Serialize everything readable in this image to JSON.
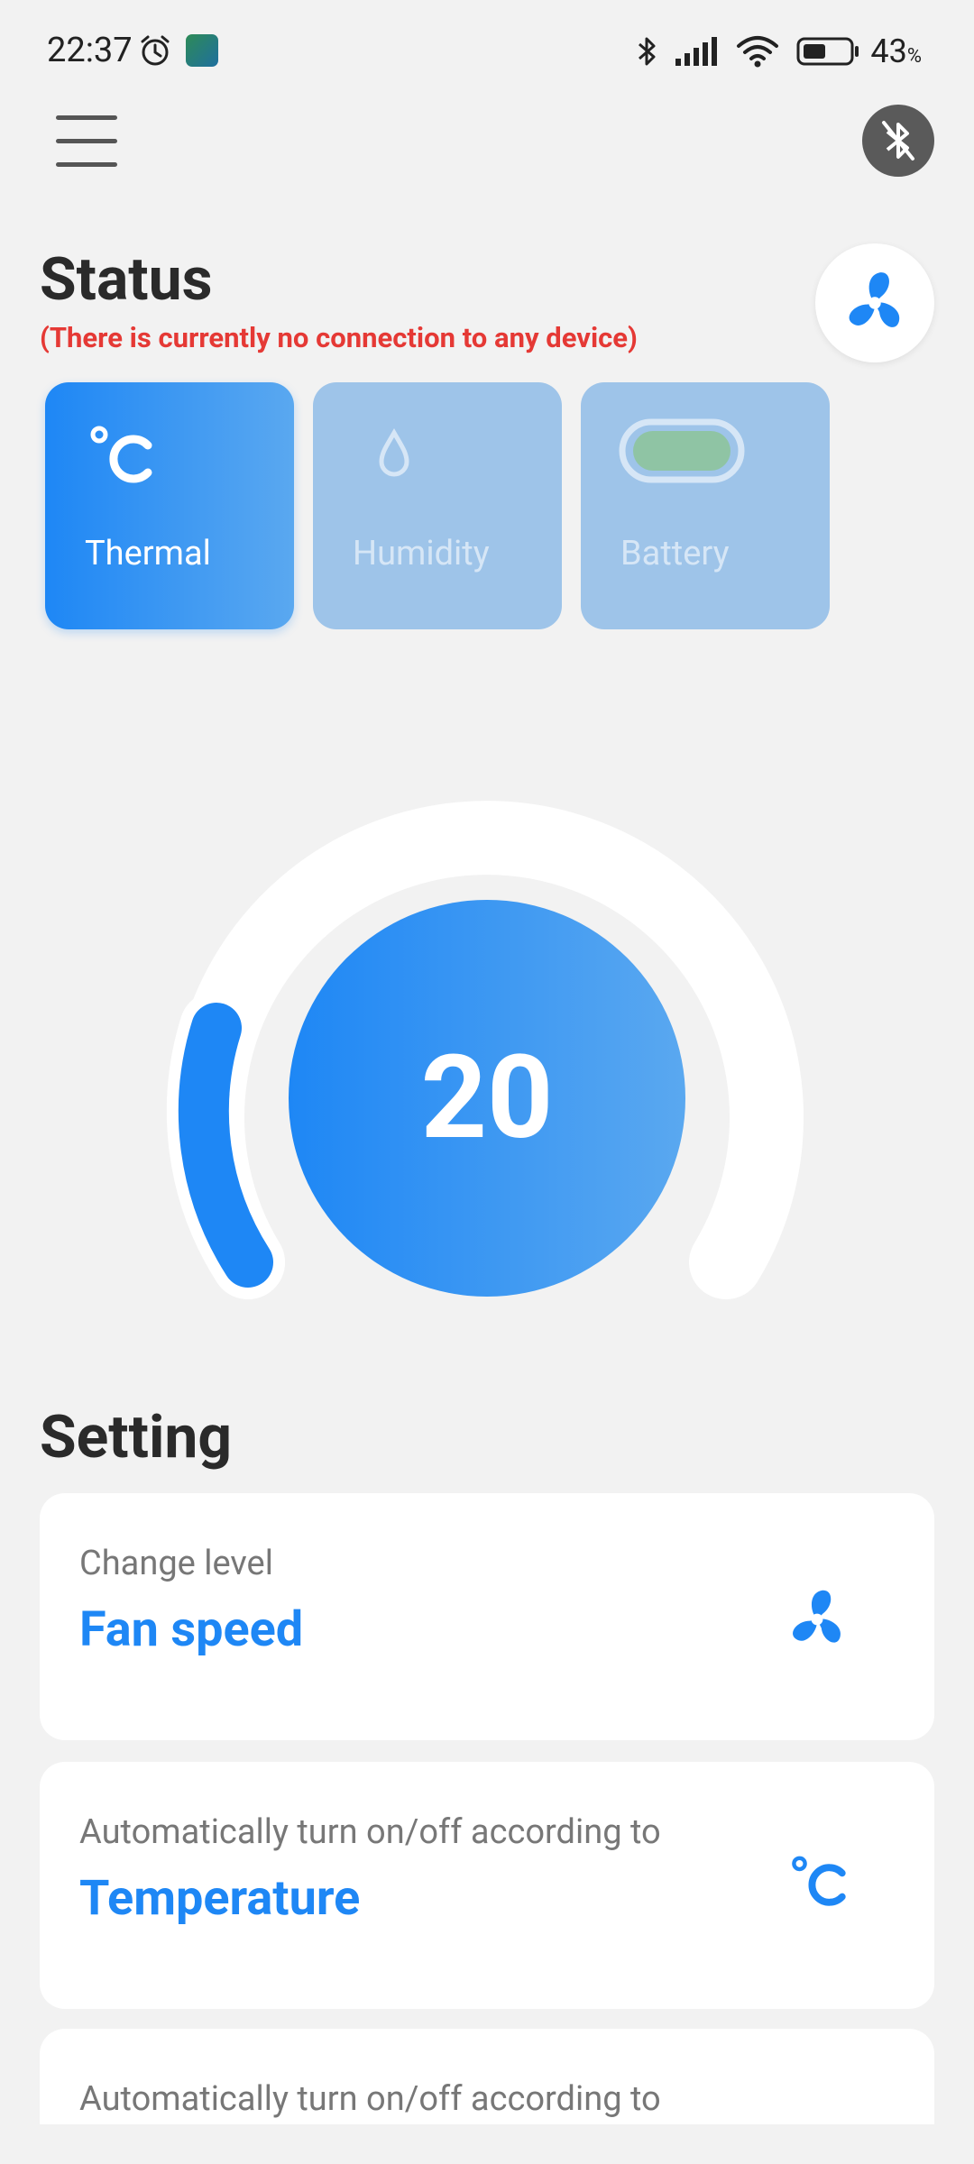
{
  "status_bar": {
    "time": "22:37",
    "battery": "43",
    "battery_unit": "%"
  },
  "status": {
    "title": "Status",
    "warning": "(There is currently no connection to any device)",
    "cards": [
      {
        "label": "Thermal",
        "icon": "celsius-icon",
        "active": true
      },
      {
        "label": "Humidity",
        "icon": "droplet-icon",
        "active": false
      },
      {
        "label": "Battery",
        "icon": "battery-pill-icon",
        "active": false
      }
    ]
  },
  "dial": {
    "value": "20"
  },
  "setting": {
    "title": "Setting",
    "items": [
      {
        "subtitle": "Change level",
        "title": "Fan speed",
        "icon": "fan-icon"
      },
      {
        "subtitle": "Automatically turn on/off according to",
        "title": "Temperature",
        "icon": "celsius-icon"
      },
      {
        "subtitle": "Automatically turn on/off according to",
        "title": "",
        "icon": ""
      }
    ]
  },
  "colors": {
    "accent": "#1e87f5",
    "warning": "#e53935",
    "inactive_card": "#9ec4e9"
  }
}
